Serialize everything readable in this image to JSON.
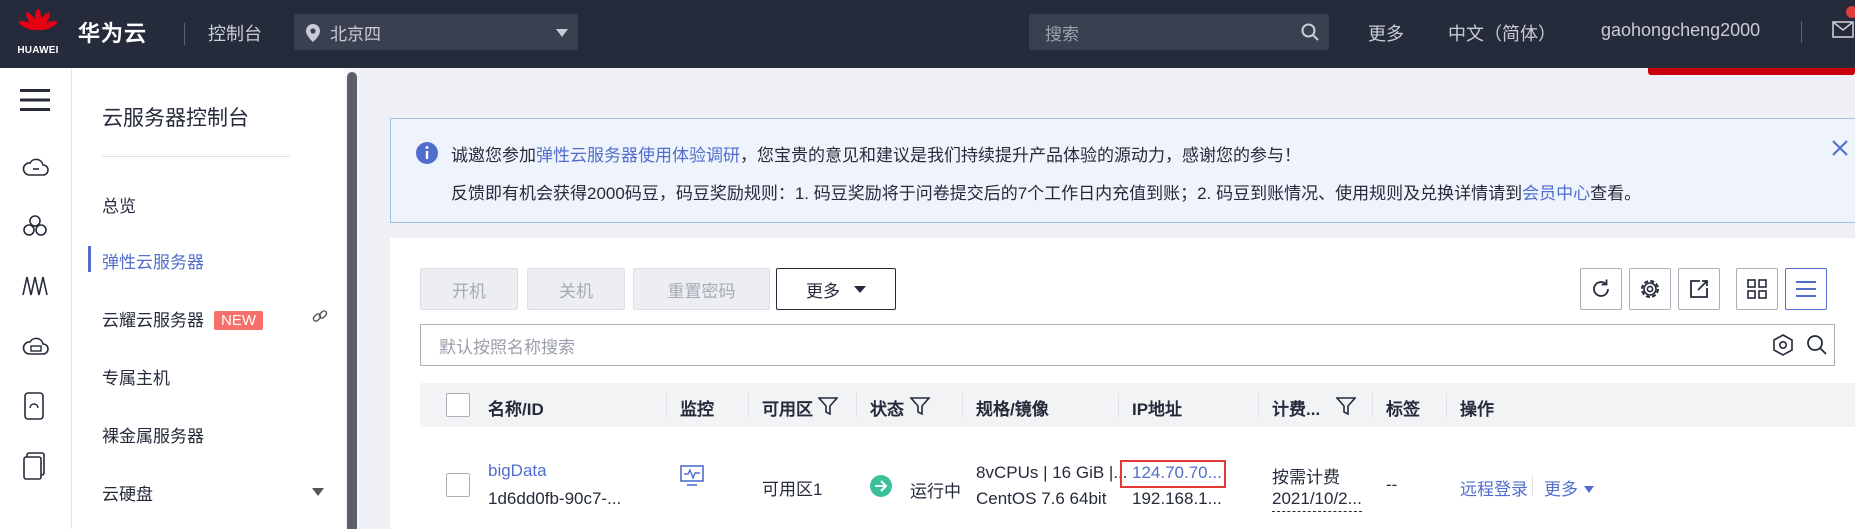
{
  "topbar": {
    "logo_text": "HUAWEI",
    "brand": "华为云",
    "console": "控制台",
    "region": "北京四",
    "search_placeholder": "搜索",
    "more": "更多",
    "language": "中文（简体）",
    "username": "gaohongcheng2000",
    "colors": {
      "background": "#252b3a",
      "logo_red": "#e60012"
    }
  },
  "rail": {
    "icons": [
      "menu-icon",
      "cloud-server-icon",
      "cluster-icon",
      "network-icon",
      "cloud-storage-icon",
      "device-icon",
      "files-icon"
    ]
  },
  "sidebar": {
    "title": "云服务器控制台",
    "items": [
      {
        "label": "总览"
      },
      {
        "label": "弹性云服务器",
        "active": true
      },
      {
        "label": "云耀云服务器",
        "badge": "NEW"
      },
      {
        "label": "专属主机"
      },
      {
        "label": "裸金属服务器"
      },
      {
        "label": "云硬盘"
      }
    ],
    "accent": "#526ecc"
  },
  "notice": {
    "line1_prefix": "诚邀您参加",
    "line1_link": "弹性云服务器使用体验调研",
    "line1_suffix": "，您宝贵的意见和建议是我们持续提升产品体验的源动力，感谢您的参与！",
    "line2_prefix": "反馈即有机会获得2000码豆，码豆奖励规则：1. 码豆奖励将于问卷提交后的7个工作日内充值到账；2. 码豆到账情况、使用规则及兑换详情请到",
    "line2_link": "会员中心",
    "line2_suffix": "查看。"
  },
  "toolbar": {
    "start": "开机",
    "stop": "关机",
    "reset_password": "重置密码",
    "more": "更多"
  },
  "search": {
    "placeholder": "默认按照名称搜索"
  },
  "table": {
    "headers": [
      "名称/ID",
      "监控",
      "可用区",
      "状态",
      "规格/镜像",
      "IP地址",
      "计费...",
      "标签",
      "操作"
    ],
    "rows": [
      {
        "name": "bigData",
        "id": "1d6dd0fb-90c7-...",
        "zone": "可用区1",
        "status": "运行中",
        "spec": "8vCPUs | 16 GiB |...",
        "image": "CentOS 7.6 64bit",
        "ip_public": "124.70.70...",
        "ip_private": "192.168.1...",
        "billing": "按需计费",
        "billing_date": "2021/10/2...",
        "tags": "--",
        "action_login": "远程登录",
        "action_more": "更多"
      }
    ]
  }
}
